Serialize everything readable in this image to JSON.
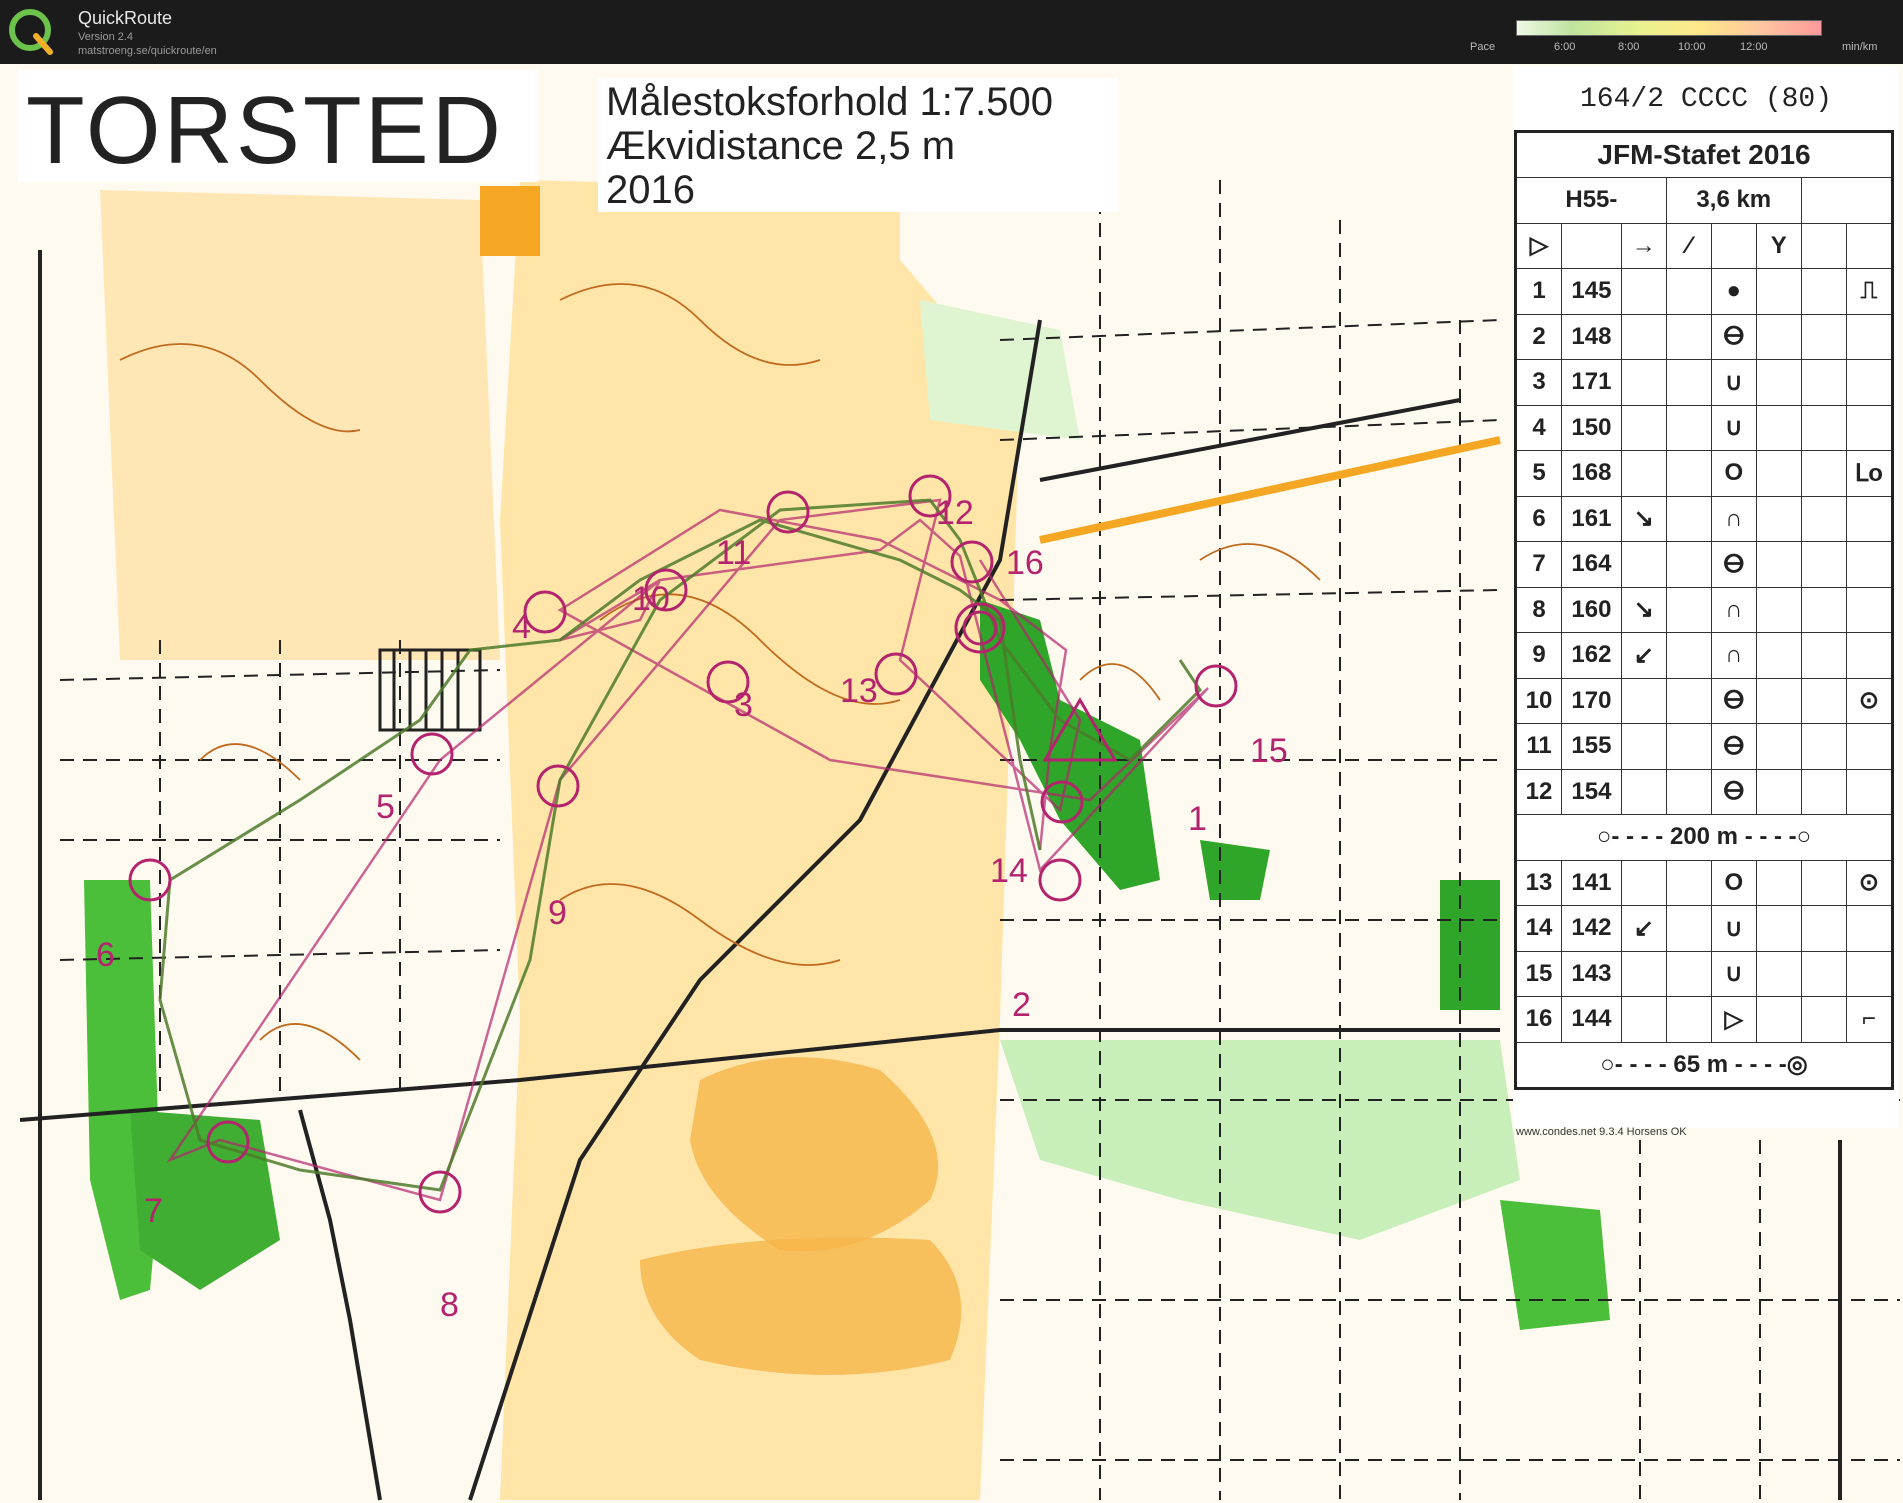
{
  "app": {
    "title": "QuickRoute",
    "version": "Version 2.4",
    "url": "matstroeng.se/quickroute/en",
    "logo_letter": "Q"
  },
  "pace_scale": {
    "label": "Pace",
    "ticks": [
      "6:00",
      "8:00",
      "10:00",
      "12:00"
    ],
    "unit": "min/km"
  },
  "map": {
    "name": "TORSTED",
    "scale_text": "Målestoksforhold 1:7.500",
    "contour_text": "Ækvidistance 2,5 m",
    "year_text": "2016",
    "footer_text": "www.condes.net 9.3.4 Horsens OK",
    "colors": {
      "course": "#b4236e",
      "route": "#4e7a2a",
      "open": "#ffd98a",
      "forest": "#4cbf3a",
      "contour": "#c06a1e"
    }
  },
  "control_description": {
    "course_code": "164/2 CCCC (80)",
    "event": "JFM-Stafet 2016",
    "class": "H55-",
    "length": "3,6 km",
    "controls": [
      {
        "num": "1",
        "code": "145",
        "feature": "●",
        "detail": "⎍"
      },
      {
        "num": "2",
        "code": "148",
        "feature": "ⴱ",
        "detail": ""
      },
      {
        "num": "3",
        "code": "171",
        "feature": "∪",
        "detail": ""
      },
      {
        "num": "4",
        "code": "150",
        "feature": "∪",
        "detail": ""
      },
      {
        "num": "5",
        "code": "168",
        "feature": "O",
        "detail": "ᒪo"
      },
      {
        "num": "6",
        "code": "161",
        "dir": "↘",
        "feature": "∩",
        "detail": ""
      },
      {
        "num": "7",
        "code": "164",
        "feature": "ⴱ",
        "detail": ""
      },
      {
        "num": "8",
        "code": "160",
        "dir": "↘",
        "feature": "∩",
        "detail": ""
      },
      {
        "num": "9",
        "code": "162",
        "dir": "↙",
        "feature": "∩",
        "detail": ""
      },
      {
        "num": "10",
        "code": "170",
        "feature": "ⴱ",
        "detail": "⊙"
      },
      {
        "num": "11",
        "code": "155",
        "feature": "ⴱ",
        "detail": ""
      },
      {
        "num": "12",
        "code": "154",
        "feature": "ⴱ",
        "detail": ""
      }
    ],
    "marked_route_1": "200 m",
    "controls_2": [
      {
        "num": "13",
        "code": "141",
        "feature": "O",
        "detail": "⊙"
      },
      {
        "num": "14",
        "code": "142",
        "dir": "↙",
        "feature": "∪",
        "detail": ""
      },
      {
        "num": "15",
        "code": "143",
        "feature": "∪",
        "detail": ""
      },
      {
        "num": "16",
        "code": "144",
        "feature": "▷",
        "detail": "⌐"
      }
    ],
    "marked_route_2": "65 m"
  },
  "control_labels": [
    "1",
    "2",
    "3",
    "4",
    "5",
    "6",
    "7",
    "8",
    "9",
    "10",
    "11",
    "12",
    "13",
    "14",
    "15",
    "16"
  ]
}
